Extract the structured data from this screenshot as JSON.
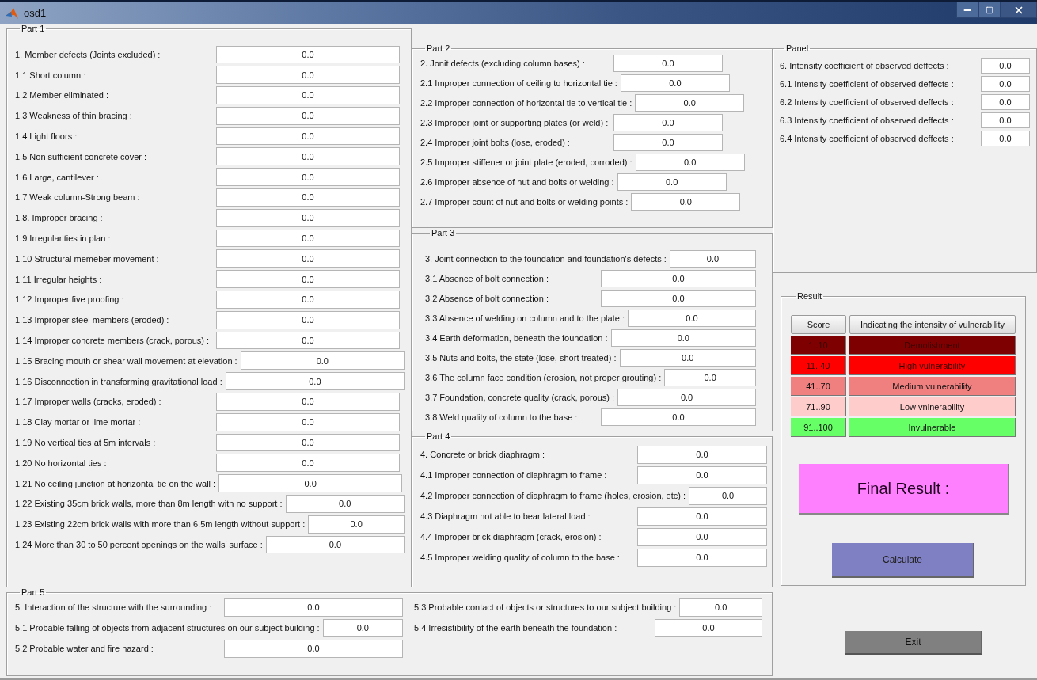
{
  "window": {
    "title": "osd1"
  },
  "part1": {
    "title": "Part 1",
    "items": [
      {
        "label": "1. Member defects (Joints excluded) :",
        "value": "0.0"
      },
      {
        "label": "1.1 Short column :",
        "value": "0.0"
      },
      {
        "label": "1.2 Member eliminated :",
        "value": "0.0"
      },
      {
        "label": "1.3 Weakness of thin bracing :",
        "value": "0.0"
      },
      {
        "label": "1.4 Light floors :",
        "value": "0.0"
      },
      {
        "label": "1.5 Non sufficient concrete cover :",
        "value": "0.0"
      },
      {
        "label": "1.6 Large, cantilever :",
        "value": "0.0"
      },
      {
        "label": "1.7 Weak column-Strong beam :",
        "value": "0.0"
      },
      {
        "label": "1.8. Improper bracing :",
        "value": "0.0"
      },
      {
        "label": "1.9 Irregularities in plan :",
        "value": "0.0"
      },
      {
        "label": "1.10 Structural memeber movement :",
        "value": "0.0"
      },
      {
        "label": "1.11 Irregular heights :",
        "value": "0.0"
      },
      {
        "label": "1.12 Improper five proofing :",
        "value": "0.0"
      },
      {
        "label": "1.13 Improper steel members (eroded) :",
        "value": "0.0"
      },
      {
        "label": "1.14 Improper concrete members (crack, porous) :",
        "value": "0.0"
      },
      {
        "label": "1.15 Bracing mouth or shear wall movement at elevation :",
        "value": "0.0"
      },
      {
        "label": "1.16 Disconnection in transforming gravitational load :",
        "value": "0.0"
      },
      {
        "label": "1.17 Improper walls (cracks, eroded) :",
        "value": "0.0"
      },
      {
        "label": "1.18 Clay mortar or lime mortar :",
        "value": "0.0"
      },
      {
        "label": "1.19 No vertical ties at 5m intervals :",
        "value": "0.0"
      },
      {
        "label": "1.20 No horizontal ties :",
        "value": "0.0"
      },
      {
        "label": "1.21 No ceiling junction at horizontal tie on the wall :",
        "value": "0.0"
      },
      {
        "label": "1.22 Existing 35cm brick walls, more than 8m length with no support :",
        "value": "0.0"
      },
      {
        "label": "1.23 Existing 22cm brick walls with more than 6.5m length without support :",
        "value": "0.0"
      },
      {
        "label": "1.24 More than 30 to 50 percent openings on the walls' surface :",
        "value": "0.0"
      }
    ]
  },
  "part2": {
    "title": "Part 2",
    "items": [
      {
        "label": "2. Jonit defects (excluding column bases) :",
        "value": "0.0"
      },
      {
        "label": "2.1 Improper connection of ceiling to horizontal tie :",
        "value": "0.0"
      },
      {
        "label": "2.2 Improper connection of horizontal tie to vertical tie :",
        "value": "0.0"
      },
      {
        "label": "2.3 Improper joint or supporting plates (or weld) :",
        "value": "0.0"
      },
      {
        "label": "2.4 Improper joint bolts (lose, eroded) :",
        "value": "0.0"
      },
      {
        "label": "2.5 Improper stiffener or joint plate (eroded, corroded) :",
        "value": "0.0"
      },
      {
        "label": "2.6 Improper absence of nut and bolts or welding :",
        "value": "0.0"
      },
      {
        "label": "2.7 Improper count of nut and bolts or welding points :",
        "value": "0.0"
      }
    ]
  },
  "part3": {
    "title": "Part 3",
    "items": [
      {
        "label": "3. Joint connection to the foundation and foundation's defects :",
        "value": "0.0"
      },
      {
        "label": "3.1 Absence of bolt connection :",
        "value": "0.0"
      },
      {
        "label": "3.2 Absence of bolt connection :",
        "value": "0.0"
      },
      {
        "label": "3.3 Absence of welding on column and to the plate :",
        "value": "0.0"
      },
      {
        "label": "3.4 Earth deformation, beneath the foundation :",
        "value": "0.0"
      },
      {
        "label": "3.5 Nuts and bolts, the state (lose, short treated) :",
        "value": "0.0"
      },
      {
        "label": "3.6 The column face condition (erosion, not proper grouting) :",
        "value": "0.0"
      },
      {
        "label": "3.7 Foundation, concrete quality (crack, porous) :",
        "value": "0.0"
      },
      {
        "label": "3.8 Weld quality of column to the base :",
        "value": "0.0"
      }
    ]
  },
  "part4": {
    "title": "Part 4",
    "items": [
      {
        "label": "4. Concrete or brick diaphragm :",
        "value": "0.0"
      },
      {
        "label": "4.1 Improper connection of diaphragm to frame :",
        "value": "0.0"
      },
      {
        "label": "4.2 Improper connection of diaphragm to frame (holes, erosion, etc) :",
        "value": "0.0"
      },
      {
        "label": "4.3 Diaphragm not able to bear lateral load :",
        "value": "0.0"
      },
      {
        "label": "4.4 Improper brick diaphragm (crack, erosion) :",
        "value": "0.0"
      },
      {
        "label": "4.5 Improper welding quality of column to the base :",
        "value": "0.0"
      }
    ]
  },
  "part5": {
    "title": "Part 5",
    "columns": [
      [
        {
          "label": "5. Interaction of the structure with the surrounding :",
          "value": "0.0"
        },
        {
          "label": "5.1 Probable falling of objects from adjacent structures on our subject building :",
          "value": "0.0"
        },
        {
          "label": "5.2 Probable water and fire hazard :",
          "value": "0.0"
        }
      ],
      [
        {
          "label": "5.3 Probable contact of objects or structures to our subject building :",
          "value": "0.0"
        },
        {
          "label": "5.4 Irresistibility of the earth beneath the foundation :",
          "value": "0.0"
        }
      ]
    ]
  },
  "panel": {
    "title": "Panel",
    "items": [
      {
        "label": "6.  Intensity coefficient of observed deffects :",
        "value": "0.0"
      },
      {
        "label": "6.1  Intensity coefficient of observed deffects :",
        "value": "0.0"
      },
      {
        "label": "6.2  Intensity coefficient of observed deffects :",
        "value": "0.0"
      },
      {
        "label": "6.3  Intensity coefficient of observed deffects :",
        "value": "0.0"
      },
      {
        "label": "6.4  Intensity coefficient of observed deffects :",
        "value": "0.0"
      }
    ]
  },
  "result": {
    "title": "Result",
    "columns": [
      "Score",
      "Indicating the intensity of vulnerability"
    ],
    "rows": [
      {
        "score": "1..10",
        "label": "Demolishment",
        "color": "#7f0000"
      },
      {
        "score": "11..40",
        "label": "High vulnerability",
        "color": "#ff0000"
      },
      {
        "score": "41..70",
        "label": "Medium vulnerability",
        "color": "#f08080"
      },
      {
        "score": "71..90",
        "label": "Low vnlnerability",
        "color": "#ffcccc"
      },
      {
        "score": "91..100",
        "label": "Invulnerable",
        "color": "#66ff66"
      }
    ],
    "final_result": "Final Result :",
    "calculate_button": "Calculate"
  },
  "exit_button": "Exit"
}
